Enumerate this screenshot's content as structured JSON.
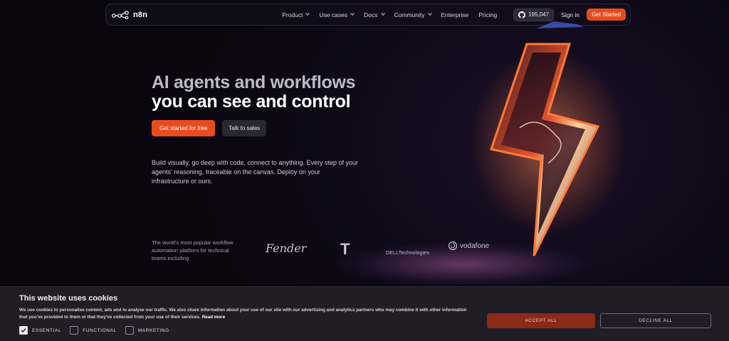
{
  "nav": {
    "logo_text": "n8n",
    "menu": [
      {
        "label": "Product",
        "dropdown": true
      },
      {
        "label": "Use cases",
        "dropdown": true
      },
      {
        "label": "Docs",
        "dropdown": true
      },
      {
        "label": "Community",
        "dropdown": true
      },
      {
        "label": "Enterprise",
        "dropdown": false
      },
      {
        "label": "Pricing",
        "dropdown": false
      }
    ],
    "github_stars": "195,047",
    "signin": "Sign in",
    "get_started": "Get Started"
  },
  "hero": {
    "title_line1": "AI agents and workflows",
    "title_line2": "you can see and control",
    "primary_cta": "Get started for free",
    "secondary_cta": "Talk to sales",
    "description": "Build visually, go deep with code, connect to anything. Every step of your agents' reasoning, traceable on the canvas. Deploy on your infrastructure or ours."
  },
  "logos": {
    "blurb": "The world's most popular workflow automation platform for technical teams including",
    "fender": "Fender",
    "tmobile": "T",
    "dell": "DELLTechnologies",
    "vodafone": "vodafone"
  },
  "cookie": {
    "title": "This website uses cookies",
    "text": "We use cookies to personalise content, ads and to analyse our traffic. We also share information about your use of our site with our advertising and analytics partners who may combine it with other information that you've provided to them or that they've collected from your use of their services.",
    "read_more": "Read more",
    "options": [
      {
        "label": "ESSENTIAL",
        "checked": true
      },
      {
        "label": "FUNCTIONAL",
        "checked": false
      },
      {
        "label": "MARKETING",
        "checked": false
      }
    ],
    "accept": "ACCEPT ALL",
    "decline": "DECLINE ALL"
  },
  "colors": {
    "accent": "#ea4b1e",
    "background": "#0b0814"
  }
}
